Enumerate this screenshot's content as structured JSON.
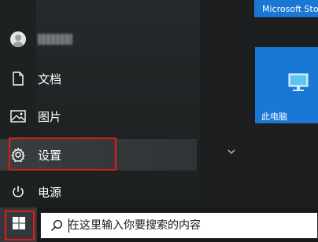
{
  "start_menu": {
    "user": {
      "avatar_icon": "user-avatar-icon",
      "name_redacted": true
    },
    "items": [
      {
        "id": "documents",
        "label": "文档",
        "icon": "document-icon"
      },
      {
        "id": "pictures",
        "label": "图片",
        "icon": "picture-icon"
      },
      {
        "id": "settings",
        "label": "设置",
        "icon": "gear-icon",
        "highlighted": true
      },
      {
        "id": "power",
        "label": "电源",
        "icon": "power-icon"
      }
    ],
    "expand_icon": "chevron-down-icon"
  },
  "tiles": {
    "store": {
      "label": "Microsoft Store"
    },
    "this_pc": {
      "label": "此电脑",
      "icon": "computer-monitor-icon"
    }
  },
  "taskbar": {
    "start_icon": "windows-logo-icon",
    "search": {
      "icon": "search-icon",
      "placeholder": "在这里输入你要搜索的内容",
      "value": ""
    }
  },
  "colors": {
    "accent_tile": "#1a78d4",
    "highlight_annotation": "#e21a1a",
    "menu_background": "#202324",
    "taskbar_background": "#18191a"
  }
}
